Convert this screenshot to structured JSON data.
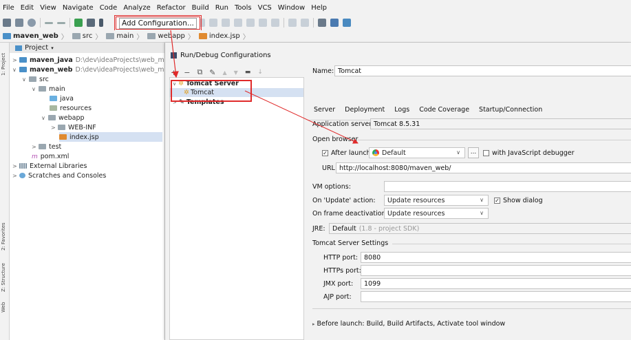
{
  "menu": [
    "File",
    "Edit",
    "View",
    "Navigate",
    "Code",
    "Analyze",
    "Refactor",
    "Build",
    "Run",
    "Tools",
    "VCS",
    "Window",
    "Help"
  ],
  "toolbar": {
    "add_config_label": "Add Configuration..."
  },
  "breadcrumb": [
    "maven_web",
    "src",
    "main",
    "webapp",
    "index.jsp"
  ],
  "project_panel": {
    "header": "Project",
    "tree": [
      {
        "label": "maven_java",
        "path": "D:\\dev\\ideaProjects\\web_maven\\"
      },
      {
        "label": "maven_web",
        "path": "D:\\dev\\ideaProjects\\web_maven\\"
      },
      {
        "label": "src"
      },
      {
        "label": "main"
      },
      {
        "label": "java"
      },
      {
        "label": "resources"
      },
      {
        "label": "webapp"
      },
      {
        "label": "WEB-INF"
      },
      {
        "label": "index.jsp"
      },
      {
        "label": "test"
      },
      {
        "label": "pom.xml"
      },
      {
        "label": "External Libraries"
      },
      {
        "label": "Scratches and Consoles"
      }
    ]
  },
  "side_strip": [
    "1: Project",
    "2: Favorites",
    "Z: Structure",
    "Web"
  ],
  "dialog": {
    "title": "Run/Debug Configurations",
    "tree": {
      "group": "Tomcat Server",
      "item": "Tomcat",
      "templates": "Templates"
    },
    "name_label": "Name:",
    "name_value": "Tomcat",
    "tabs": [
      "Server",
      "Deployment",
      "Logs",
      "Code Coverage",
      "Startup/Connection"
    ],
    "app_server_label": "Application server:",
    "app_server_value": "Tomcat 8.5.31",
    "open_browser_label": "Open browser",
    "after_launch_label": "After launch",
    "browser_value": "Default",
    "ellipsis": "...",
    "js_debugger_label": "with JavaScript debugger",
    "url_label": "URL:",
    "url_value": "http://localhost:8080/maven_web/",
    "vm_options_label": "VM options:",
    "on_update_label": "On 'Update' action:",
    "on_update_value": "Update resources",
    "show_dialog_label": "Show dialog",
    "on_frame_label": "On frame deactivation:",
    "on_frame_value": "Update resources",
    "jre_label": "JRE:",
    "jre_value": "Default",
    "jre_hint": "(1.8 - project SDK)",
    "tomcat_settings_label": "Tomcat Server Settings",
    "http_port_label": "HTTP port:",
    "http_port_value": "8080",
    "https_port_label": "HTTPs port:",
    "https_port_value": "",
    "jmx_port_label": "JMX port:",
    "jmx_port_value": "1099",
    "ajp_port_label": "AJP port:",
    "ajp_port_value": "",
    "before_launch_label": "Before launch: Build, Build Artifacts, Activate tool window"
  },
  "colors": {
    "highlight": "#e02a2a",
    "selection": "#d5e1f2",
    "folder": "#4a90c8"
  }
}
